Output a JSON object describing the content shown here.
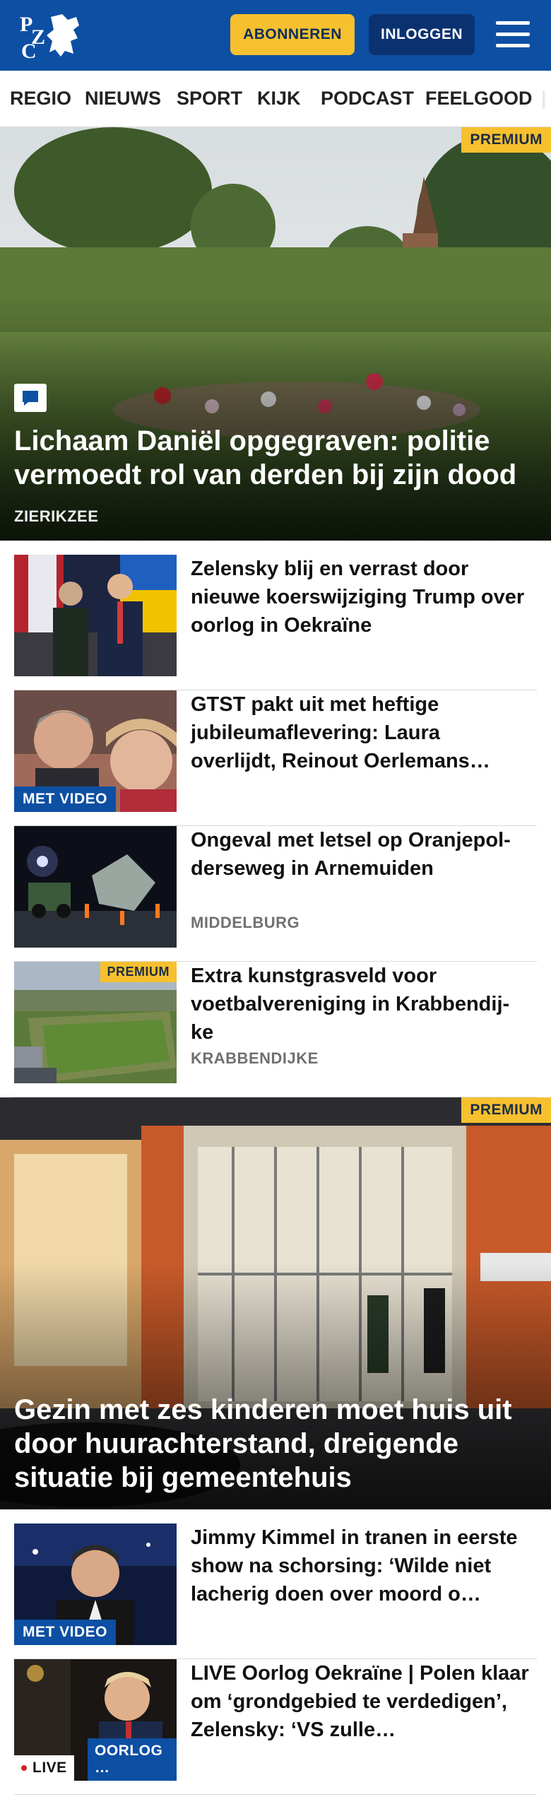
{
  "header": {
    "logo_text": "PZC",
    "subscribe_label": "ABONNEREN",
    "login_label": "INLOGGEN",
    "menu_icon": "hamburger-menu-icon",
    "brand_color": "#0d4fa3",
    "accent_color": "#f6c02e"
  },
  "nav": {
    "items": [
      "REGIO",
      "NIEUWS",
      "SPORT",
      "KIJK",
      "PODCAST",
      "FEELGOOD"
    ]
  },
  "hero1": {
    "badge": "PREMIUM",
    "title": "Lichaam Daniël opgegraven: politie vermoedt rol van derden bij zijn dood",
    "location": "ZIERIKZEE",
    "icon": "comment-icon"
  },
  "articles1": [
    {
      "title": "Zelensky blij en verrast door nieuwe koerswijziging Trump over oorlog in Oekraïne"
    },
    {
      "title": "GTST pakt uit met heftige jubileumaflevering: Laura overlijdt, Reinout Oerlemans…",
      "tag": "MET VIDEO"
    },
    {
      "title": "Ongeval met letsel op Oranjepol-derseweg in Arnemuiden",
      "location": "MIDDELBURG"
    },
    {
      "title": "Extra kunstgrasveld voor voetbalvereniging in Krabbendij-ke",
      "location": "KRABBENDIJKE",
      "badge": "PREMIUM"
    }
  ],
  "hero2": {
    "badge": "PREMIUM",
    "title": "Gezin met zes kinderen moet huis uit door huurachterstand, dreigende situatie bij gemeentehuis"
  },
  "articles2": [
    {
      "title": "Jimmy Kimmel in tranen in eerste show na schorsing: ‘Wilde niet lacherig doen over moord o…",
      "tag": "MET VIDEO"
    },
    {
      "title": "LIVE Oorlog Oekraïne | Polen klaar om ‘grondgebied te verdedigen’, Zelensky: ‘VS zulle…",
      "live": "LIVE",
      "topic": "OORLOG …"
    }
  ]
}
